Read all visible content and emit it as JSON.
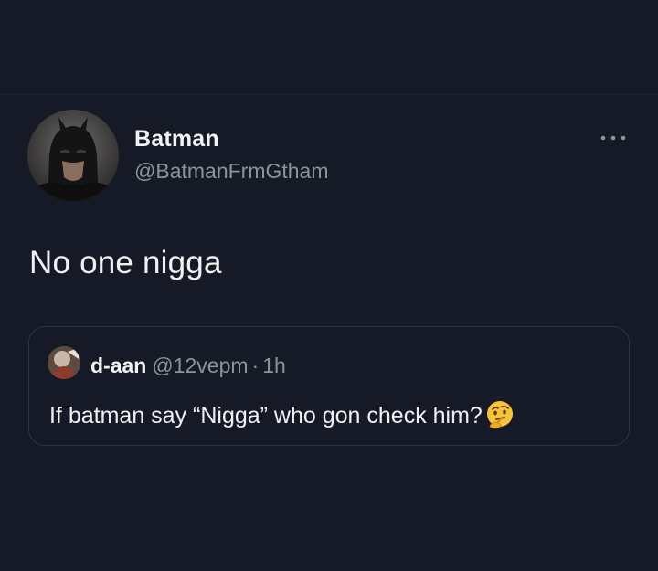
{
  "tweet": {
    "author": {
      "display_name": "Batman",
      "handle": "@BatmanFrmGtham",
      "avatar_icon": "batman-avatar"
    },
    "text": "No one nigga",
    "more_icon": "more-horizontal-icon",
    "quoted": {
      "display_name": "d-aan",
      "handle": "@12vepm",
      "separator": "·",
      "time": "1h",
      "text": "If batman say “Nigga” who gon check him?",
      "emoji": "thinking-face-icon"
    }
  },
  "colors": {
    "background": "#161a27",
    "text_primary": "#f0f1f3",
    "text_secondary": "#8c939c",
    "card_border": "#2d3340"
  }
}
